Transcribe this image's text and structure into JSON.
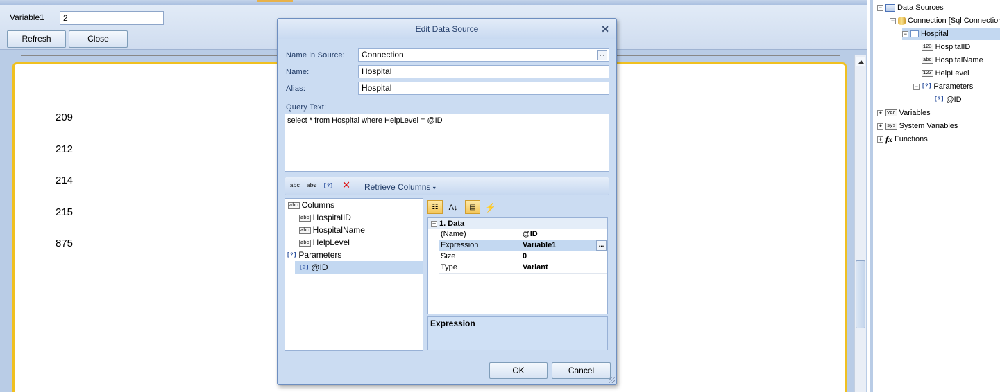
{
  "variables_bar": {
    "label": "Variable1",
    "value": "2",
    "refresh_label": "Refresh",
    "close_label": "Close"
  },
  "report": {
    "values": [
      "209",
      "212",
      "214",
      "215",
      "875"
    ]
  },
  "dictionary": {
    "data_sources": "Data Sources",
    "connection": "Connection [Sql Connection",
    "hospital": "Hospital",
    "columns": [
      "HospitalID",
      "HospitalName",
      "HelpLevel"
    ],
    "parameters": "Parameters",
    "param_id": "@ID",
    "variables": "Variables",
    "system_variables": "System Variables",
    "functions": "Functions"
  },
  "dialog": {
    "title": "Edit Data Source",
    "name_in_source_label": "Name in Source:",
    "name_in_source": "Connection",
    "name_label": "Name:",
    "name": "Hospital",
    "alias_label": "Alias:",
    "alias": "Hospital",
    "query_label": "Query Text:",
    "query": "select * from Hospital where HelpLevel = @ID",
    "retrieve_label": "Retrieve Columns",
    "tree": {
      "columns": "Columns",
      "items": [
        "HospitalID",
        "HospitalName",
        "HelpLevel"
      ],
      "parameters": "Parameters",
      "param": "@ID"
    },
    "props": {
      "category": "1. Data",
      "rows": [
        {
          "k": "(Name)",
          "v": "@ID"
        },
        {
          "k": "Expression",
          "v": "Variable1"
        },
        {
          "k": "Size",
          "v": "0"
        },
        {
          "k": "Type",
          "v": "Variant"
        }
      ],
      "desc_title": "Expression"
    },
    "ok_label": "OK",
    "cancel_label": "Cancel"
  }
}
